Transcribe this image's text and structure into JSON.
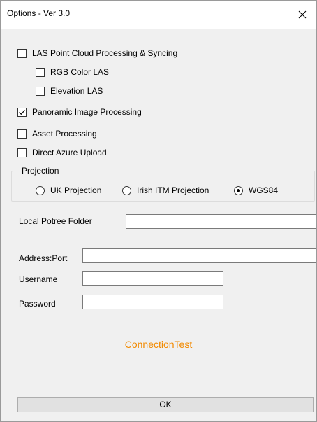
{
  "window": {
    "title": "Options - Ver 3.0",
    "close_icon": "close-icon"
  },
  "options": {
    "las": {
      "label": "LAS Point Cloud Processing & Syncing",
      "checked": false
    },
    "rgb": {
      "label": "RGB Color LAS",
      "checked": false
    },
    "elevation": {
      "label": "Elevation LAS",
      "checked": false
    },
    "panoramic": {
      "label": "Panoramic Image Processing",
      "checked": true
    },
    "asset": {
      "label": "Asset Processing",
      "checked": false
    },
    "azure": {
      "label": "Direct Azure Upload",
      "checked": false
    }
  },
  "projection": {
    "group_label": "Projection",
    "options": [
      {
        "label": "UK Projection",
        "selected": false
      },
      {
        "label": "Irish ITM Projection",
        "selected": false
      },
      {
        "label": "WGS84",
        "selected": true
      }
    ]
  },
  "fields": {
    "potree_label": "Local Potree Folder",
    "potree_value": "",
    "address_label": "Address:Port",
    "address_value": "",
    "username_label": "Username",
    "username_value": "",
    "password_label": "Password",
    "password_value": ""
  },
  "actions": {
    "connection_test": "ConnectionTest",
    "ok": "OK"
  }
}
